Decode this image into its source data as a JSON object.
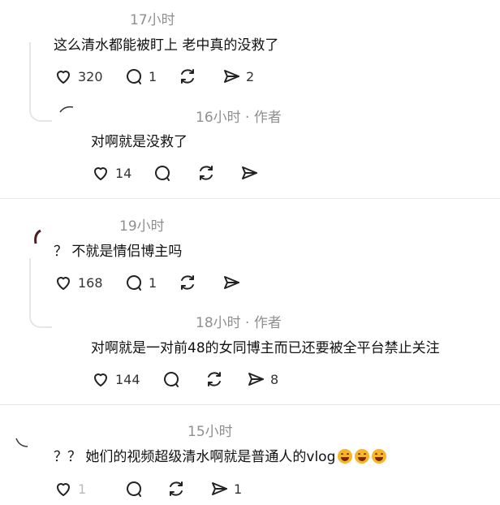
{
  "comments": [
    {
      "time": "17小时",
      "text": "这么清水都能被盯上 老中真的没救了",
      "likes": "320",
      "replies": "1",
      "shares": "2",
      "reply": {
        "meta": "16小时 · 作者",
        "text": "对啊就是没救了",
        "likes": "14",
        "shares": ""
      }
    },
    {
      "time": "19小时",
      "text": "？ 不就是情侣博主吗",
      "likes": "168",
      "replies": "1",
      "shares": "",
      "reply": {
        "meta": "18小时 · 作者",
        "text": "对啊就是一对前48的女同博主而已还要被全平台禁止关注",
        "likes": "144",
        "shares": "8"
      }
    },
    {
      "time": "15小时",
      "text": "？？ 她们的视频超级清水啊就是普通人的vlog",
      "likes": "1",
      "replies": "",
      "shares": "1"
    }
  ],
  "icons": [
    "heart-icon",
    "comment-icon",
    "repost-icon",
    "share-icon",
    "laugh-emoji-icon"
  ]
}
